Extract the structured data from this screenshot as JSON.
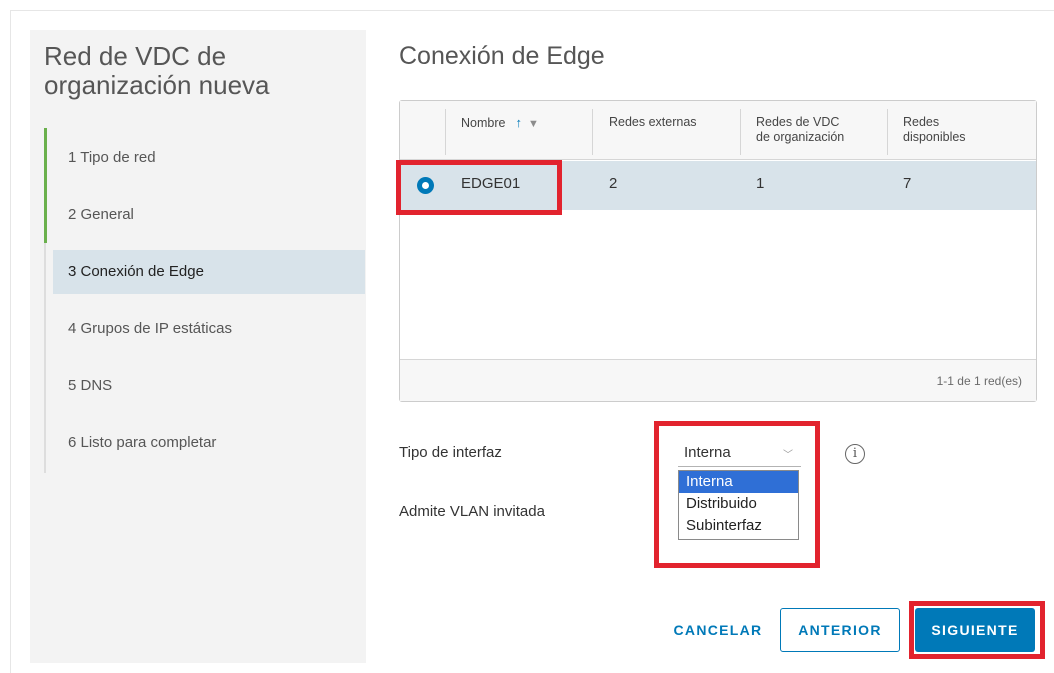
{
  "sidebar": {
    "title": "Red de VDC de organización nueva",
    "steps": [
      {
        "label": "1 Tipo de red"
      },
      {
        "label": "2 General"
      },
      {
        "label": "3 Conexión de Edge"
      },
      {
        "label": "4 Grupos de IP estáticas"
      },
      {
        "label": "5 DNS"
      },
      {
        "label": "6  Listo para completar"
      }
    ],
    "active_step": "3 Conexión de Edge"
  },
  "main": {
    "title": "Conexión de Edge",
    "table": {
      "columns": [
        {
          "label": "Nombre",
          "sortable": true,
          "filterable": true
        },
        {
          "label": "Redes externas"
        },
        {
          "label": "Redes de VDC\nde organización"
        },
        {
          "label": "Redes\ndisponibles"
        }
      ],
      "rows": [
        {
          "selected": true,
          "nombre": "EDGE01",
          "redes_externas": "2",
          "redes_vdc": "1",
          "redes_disponibles": "7"
        }
      ],
      "footer": "1-1 de 1 red(es)"
    },
    "interface_type": {
      "label": "Tipo de interfaz",
      "value": "Interna",
      "options": [
        "Interna",
        "Distribuido",
        "Subinterfaz"
      ],
      "highlighted_option": "Interna"
    },
    "guest_vlan": {
      "label": "Admite VLAN invitada"
    },
    "info_icon_glyph": "i"
  },
  "buttons": {
    "cancel": "CANCELAR",
    "previous": "ANTERIOR",
    "next": "SIGUIENTE"
  },
  "colors": {
    "accent": "#0079b8",
    "annotation_red": "#e2232e",
    "step_done_green": "#6ab04c",
    "selected_row": "#d8e3ea",
    "dropdown_highlight": "#2f6fd6"
  }
}
